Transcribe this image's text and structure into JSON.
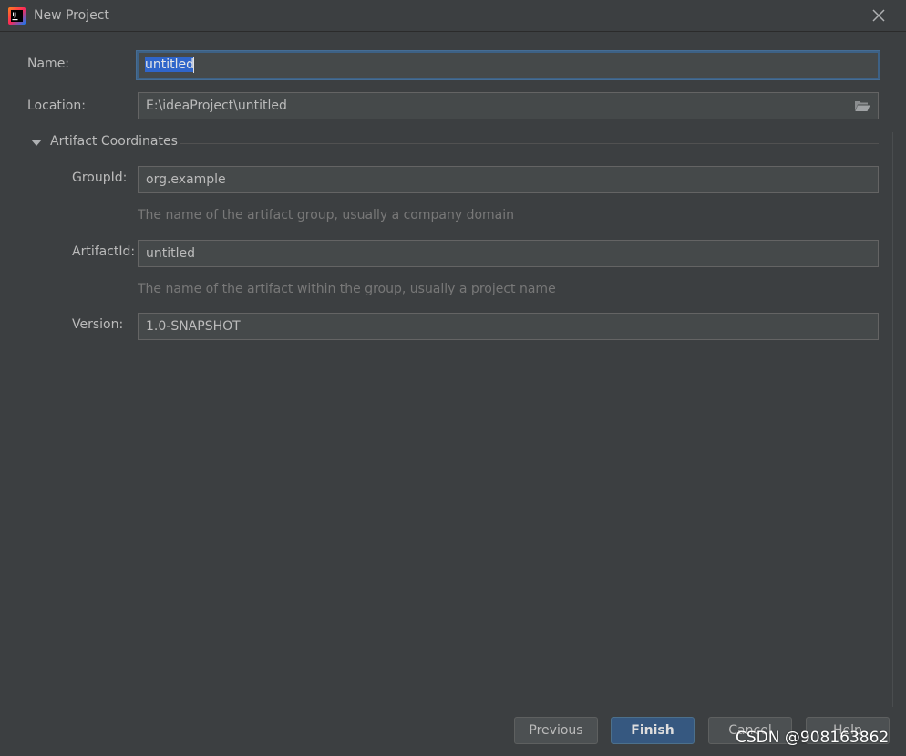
{
  "window": {
    "title": "New Project",
    "app_icon": "intellij-idea-icon",
    "close_icon": "close-icon"
  },
  "form": {
    "name": {
      "label": "Name:",
      "value": "untitled"
    },
    "location": {
      "label": "Location:",
      "value": "E:\\ideaProject\\untitled",
      "browse_icon": "folder-open-icon"
    },
    "artifact_section": {
      "title": "Artifact Coordinates",
      "expanded": true,
      "group_id": {
        "label": "GroupId:",
        "value": "org.example",
        "hint": "The name of the artifact group, usually a company domain"
      },
      "artifact_id": {
        "label": "ArtifactId:",
        "value": "untitled",
        "hint": "The name of the artifact within the group, usually a project name"
      },
      "version": {
        "label": "Version:",
        "value": "1.0-SNAPSHOT"
      }
    }
  },
  "buttons": {
    "previous": "Previous",
    "finish": "Finish",
    "cancel": "Cancel",
    "help": "Help"
  },
  "watermark": "CSDN @908163862",
  "colors": {
    "background": "#3c3f41",
    "field_background": "#45494a",
    "focus_border": "#3d6185",
    "selection": "#2f65ca",
    "primary_button": "#365880",
    "hint_text": "#787878"
  }
}
